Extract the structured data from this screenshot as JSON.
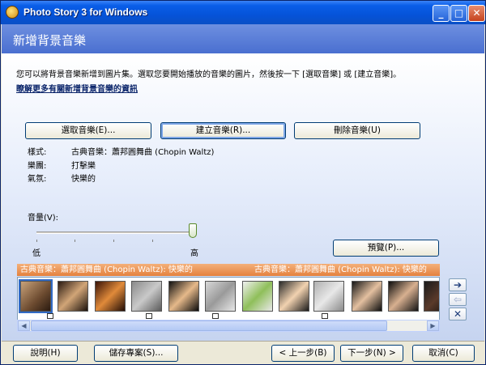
{
  "window": {
    "title": "Photo Story 3 for Windows",
    "min": "_",
    "max": "□",
    "close": "✕"
  },
  "header": {
    "title": "新增背景音樂"
  },
  "intro": {
    "text": "您可以將背景音樂新增到圖片集。選取您要開始播放的音樂的圖片，然後按一下 [選取音樂] 或 [建立音樂]。",
    "link": "瞭解更多有關新增背景音樂的資訊"
  },
  "buttons": {
    "select_music": "選取音樂(E)...",
    "create_music": "建立音樂(R)...",
    "delete_music": "刪除音樂(U)",
    "preview": "預覽(P)..."
  },
  "info": [
    {
      "key": "樣式:",
      "value": "古典音樂：蕭邦圓舞曲 (Chopin Waltz)"
    },
    {
      "key": "樂團:",
      "value": "打擊樂"
    },
    {
      "key": "氣氛:",
      "value": "快樂的"
    }
  ],
  "volume": {
    "label": "音量(V):",
    "low": "低",
    "high": "高",
    "level": 1.0
  },
  "music_bar": {
    "segments": [
      "古典音樂：蕭邦圓舞曲 (Chopin Waltz): 快樂的",
      "古典音樂：蕭邦圓舞曲 (Chopin Waltz): 快樂的"
    ]
  },
  "side_controls": {
    "move_right": "➔",
    "move_left": "⇦",
    "delete": "✕"
  },
  "scroll": {
    "left": "◀",
    "right": "▶"
  },
  "footer": {
    "help": "說明(H)",
    "save": "儲存專案(S)...",
    "back": "< 上一步(B)",
    "next": "下一步(N) >",
    "cancel": "取消(C)"
  },
  "filmstrip": {
    "frame_count": 12
  },
  "colors": {
    "titlebar": "#0553d9",
    "header": "#5a7fd8",
    "music_bar": "#e4813e"
  }
}
